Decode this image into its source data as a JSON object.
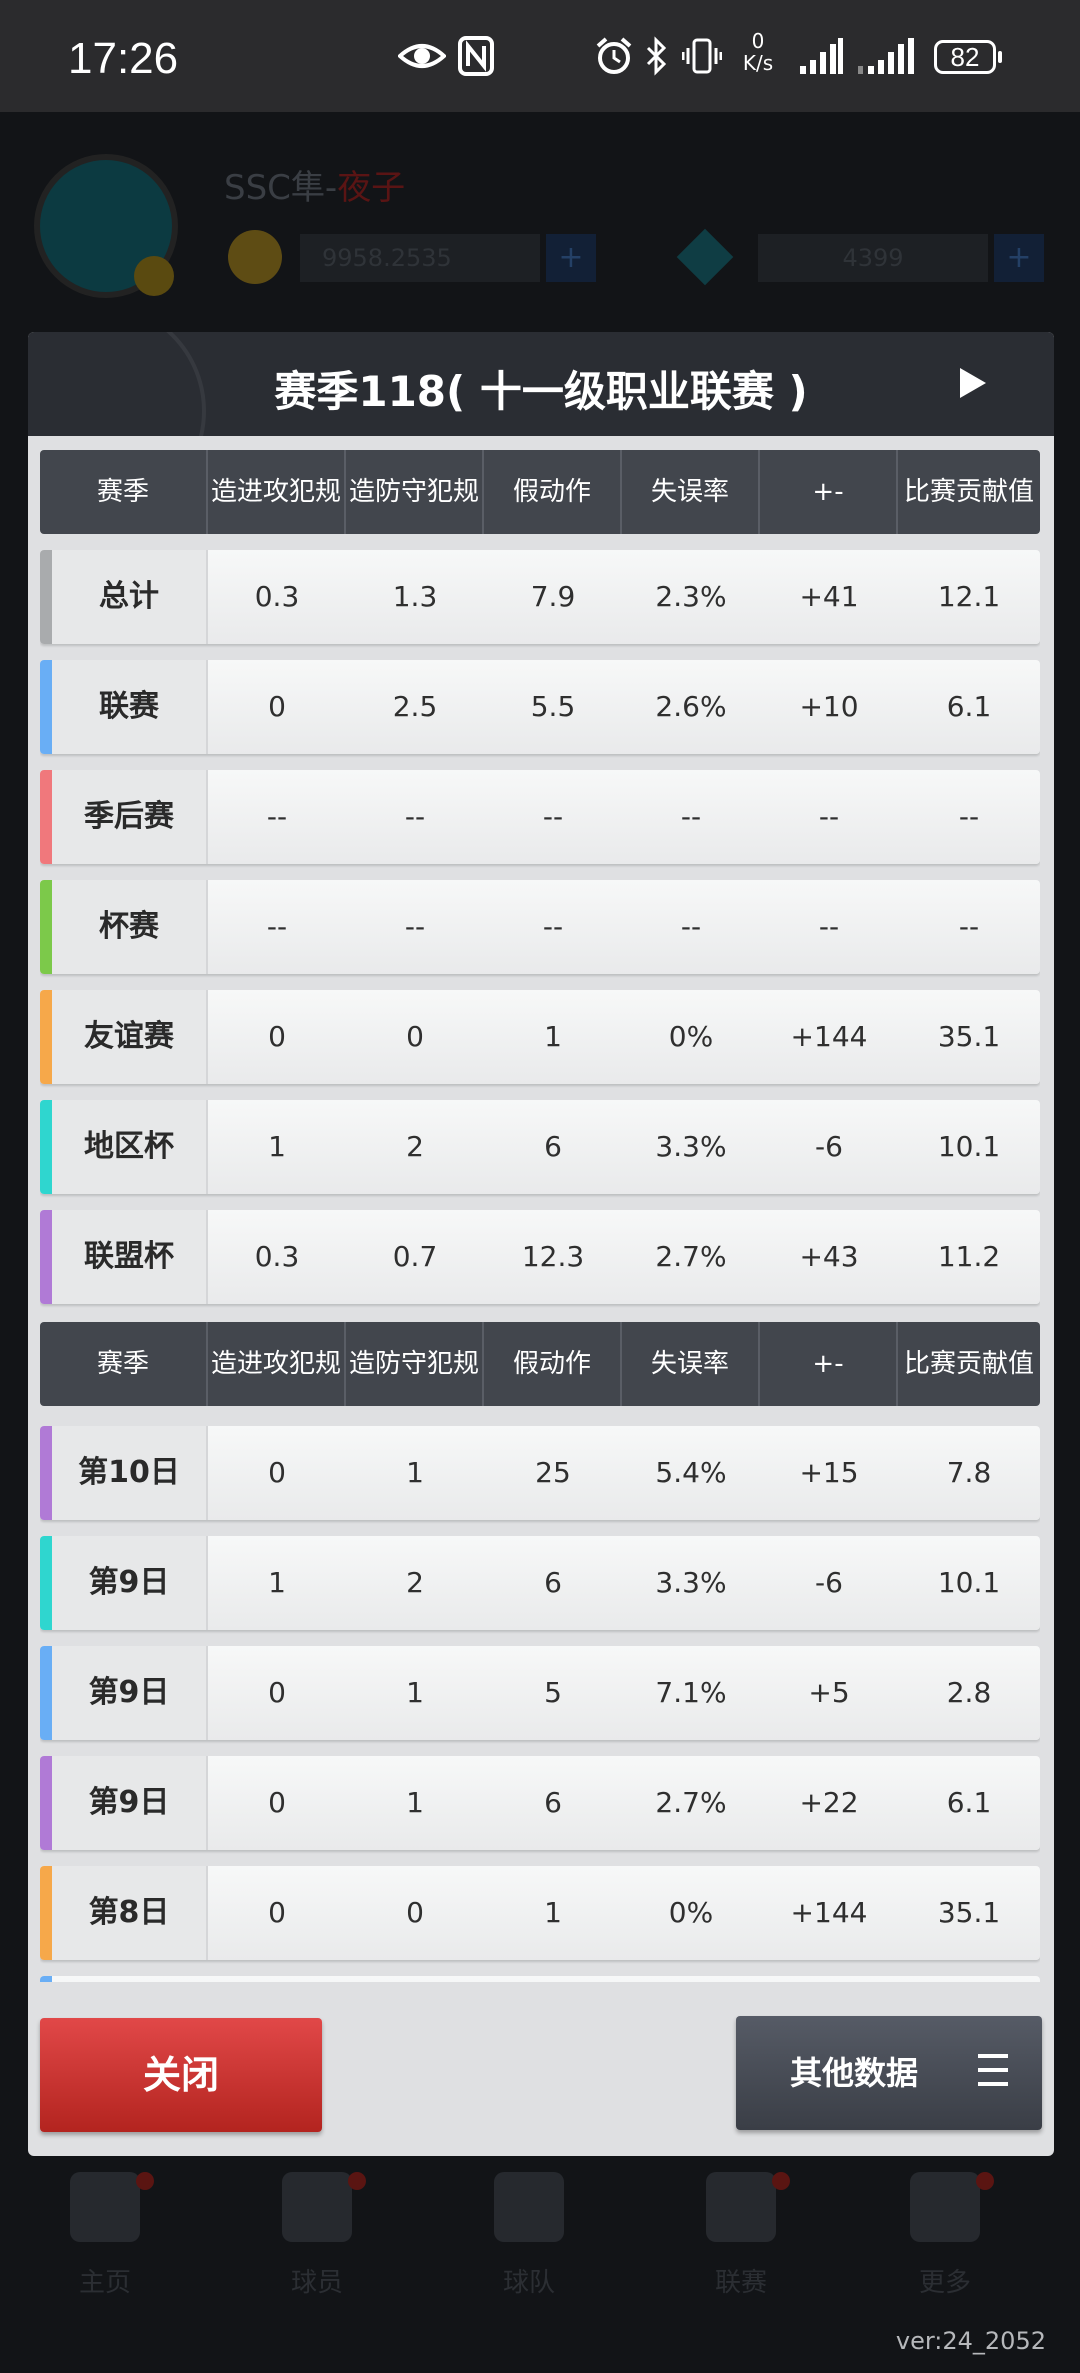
{
  "status_bar": {
    "time": "17:26",
    "net_speed_value": "0",
    "net_speed_unit": "K/s",
    "battery": "82"
  },
  "background": {
    "name_prefix": "SSC隼-",
    "name_suffix": "夜子",
    "gold": "9958.2535",
    "diamonds": "4399",
    "nav": [
      "主页",
      "球员",
      "球队",
      "联赛",
      "更多"
    ]
  },
  "modal": {
    "title": "赛季118( 十一级职业联赛 )",
    "columns": [
      "赛季",
      "造进攻犯规",
      "造防守犯规",
      "假动作",
      "失误率",
      "+-",
      "比赛贡献值"
    ],
    "season_rows": [
      {
        "label": "总计",
        "accent": "#a9abad",
        "values": [
          "0.3",
          "1.3",
          "7.9",
          "2.3%",
          "+41",
          "12.1"
        ]
      },
      {
        "label": "联赛",
        "accent": "#69aef5",
        "values": [
          "0",
          "2.5",
          "5.5",
          "2.6%",
          "+10",
          "6.1"
        ]
      },
      {
        "label": "季后赛",
        "accent": "#f0787c",
        "values": [
          "--",
          "--",
          "--",
          "--",
          "--",
          "--"
        ]
      },
      {
        "label": "杯赛",
        "accent": "#7cc94a",
        "values": [
          "--",
          "--",
          "--",
          "--",
          "--",
          "--"
        ]
      },
      {
        "label": "友谊赛",
        "accent": "#f6a84a",
        "values": [
          "0",
          "0",
          "1",
          "0%",
          "+144",
          "35.1"
        ]
      },
      {
        "label": "地区杯",
        "accent": "#2fd6cf",
        "values": [
          "1",
          "2",
          "6",
          "3.3%",
          "-6",
          "10.1"
        ]
      },
      {
        "label": "联盟杯",
        "accent": "#b07ad6",
        "values": [
          "0.3",
          "0.7",
          "12.3",
          "2.7%",
          "+43",
          "11.2"
        ]
      }
    ],
    "game_rows": [
      {
        "label": "第10日",
        "accent": "#b07ad6",
        "values": [
          "0",
          "1",
          "25",
          "5.4%",
          "+15",
          "7.8"
        ]
      },
      {
        "label": "第9日",
        "accent": "#2fd6cf",
        "values": [
          "1",
          "2",
          "6",
          "3.3%",
          "-6",
          "10.1"
        ]
      },
      {
        "label": "第9日",
        "accent": "#69aef5",
        "values": [
          "0",
          "1",
          "5",
          "7.1%",
          "+5",
          "2.8"
        ]
      },
      {
        "label": "第9日",
        "accent": "#b07ad6",
        "values": [
          "0",
          "1",
          "6",
          "2.7%",
          "+22",
          "6.1"
        ]
      },
      {
        "label": "第8日",
        "accent": "#f6a84a",
        "values": [
          "0",
          "0",
          "1",
          "0%",
          "+144",
          "35.1"
        ]
      }
    ],
    "close_label": "关闭",
    "other_label": "其他数据"
  },
  "version": "ver:24_2052"
}
